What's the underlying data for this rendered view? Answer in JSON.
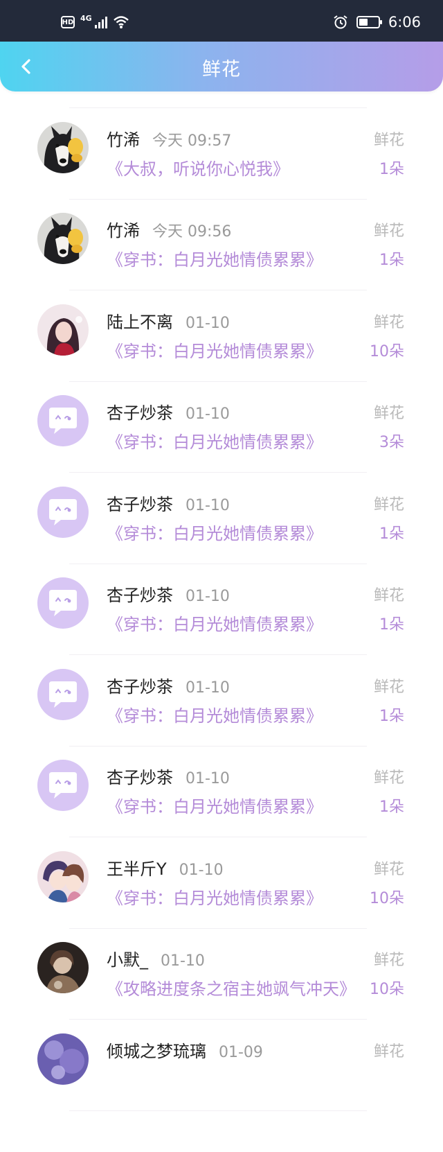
{
  "status": {
    "network": "4G",
    "hd": "HD",
    "time": "6:06"
  },
  "header": {
    "title": "鲜花",
    "back_icon": "chevron-left-icon"
  },
  "colors": {
    "accent": "#b48bd8",
    "header_start": "#4fd4f0",
    "header_end": "#b59de8"
  },
  "records": [
    {
      "name": "",
      "time": "",
      "book": "《穿书：白月光她情债累累》",
      "type": "",
      "amount": "10朵",
      "avatar": "sketch"
    },
    {
      "name": "竹浠",
      "time": "今天 09:57",
      "book": "《大叔，听说你心悦我》",
      "type": "鲜花",
      "amount": "1朵",
      "avatar": "dog"
    },
    {
      "name": "竹浠",
      "time": "今天 09:56",
      "book": "《穿书：白月光她情债累累》",
      "type": "鲜花",
      "amount": "1朵",
      "avatar": "dog"
    },
    {
      "name": "陆上不离",
      "time": "01-10",
      "book": "《穿书：白月光她情债累累》",
      "type": "鲜花",
      "amount": "10朵",
      "avatar": "girl"
    },
    {
      "name": "杏子炒茶",
      "time": "01-10",
      "book": "《穿书：白月光她情债累累》",
      "type": "鲜花",
      "amount": "3朵",
      "avatar": "default"
    },
    {
      "name": "杏子炒茶",
      "time": "01-10",
      "book": "《穿书：白月光她情债累累》",
      "type": "鲜花",
      "amount": "1朵",
      "avatar": "default"
    },
    {
      "name": "杏子炒茶",
      "time": "01-10",
      "book": "《穿书：白月光她情债累累》",
      "type": "鲜花",
      "amount": "1朵",
      "avatar": "default"
    },
    {
      "name": "杏子炒茶",
      "time": "01-10",
      "book": "《穿书：白月光她情债累累》",
      "type": "鲜花",
      "amount": "1朵",
      "avatar": "default"
    },
    {
      "name": "杏子炒茶",
      "time": "01-10",
      "book": "《穿书：白月光她情债累累》",
      "type": "鲜花",
      "amount": "1朵",
      "avatar": "default"
    },
    {
      "name": "王半斤Y",
      "time": "01-10",
      "book": "《穿书：白月光她情债累累》",
      "type": "鲜花",
      "amount": "10朵",
      "avatar": "anime"
    },
    {
      "name": "小默_",
      "time": "01-10",
      "book": "《攻略进度条之宿主她飒气冲天》",
      "type": "鲜花",
      "amount": "10朵",
      "avatar": "portrait"
    },
    {
      "name": "倾城之梦琉璃",
      "time": "01-09",
      "book": "",
      "type": "鲜花",
      "amount": "",
      "avatar": "purple"
    }
  ]
}
